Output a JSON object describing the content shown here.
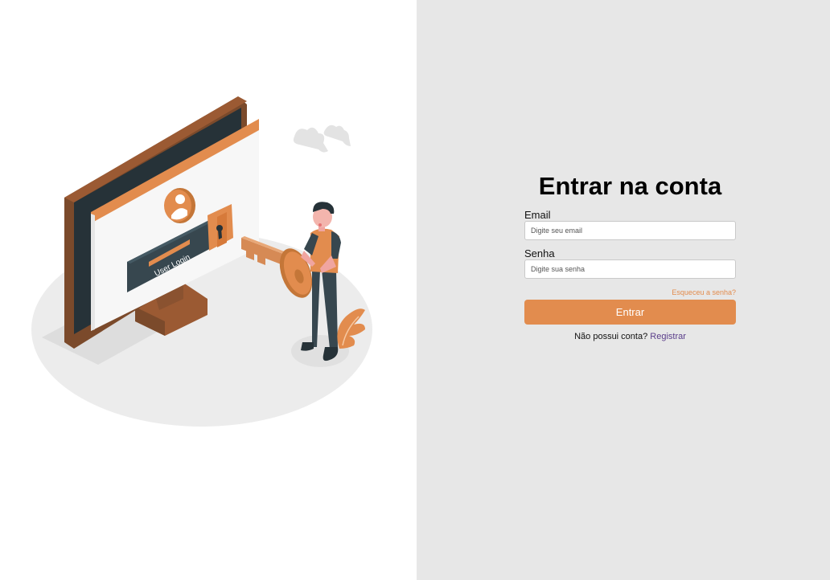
{
  "form": {
    "title": "Entrar na conta",
    "email_label": "Email",
    "email_placeholder": "Digite seu email",
    "email_value": "",
    "password_label": "Senha",
    "password_placeholder": "Digite sua senha",
    "password_value": "",
    "forgot_link": "Esqueceu a senha?",
    "submit_label": "Entrar",
    "no_account_text": "Não possui conta?",
    "register_link": "Registrar"
  },
  "illustration": {
    "screen_text": "User Login"
  },
  "colors": {
    "accent": "#e28c4e",
    "right_panel_bg": "#e7e7e7",
    "link_purple": "#5a3d8a",
    "dark": "#37474f",
    "monitor_brown": "#7b4a2b"
  }
}
